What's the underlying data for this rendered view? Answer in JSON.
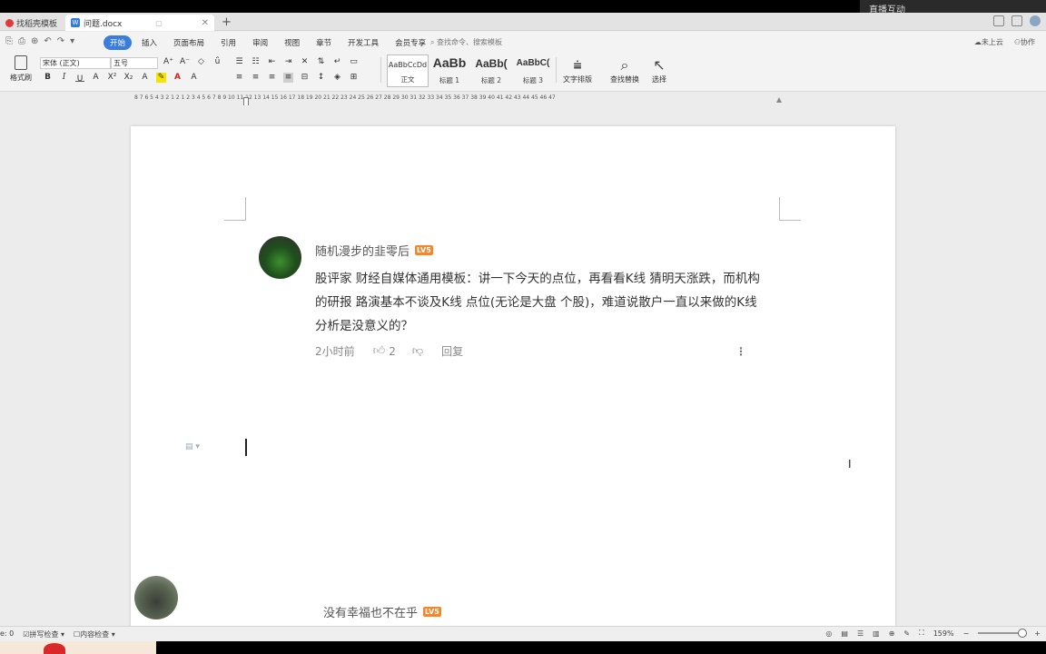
{
  "window": {
    "top_right_text": "直播互动"
  },
  "tabs": [
    {
      "label": "找稻壳模板"
    },
    {
      "label": "问题.docx",
      "icon": "W"
    }
  ],
  "tab_add": "+",
  "quick_access": [
    "⎘",
    "⎙",
    "⊕",
    "↶",
    "↷",
    "▾"
  ],
  "menu": {
    "items": [
      "开始",
      "插入",
      "页面布局",
      "引用",
      "审阅",
      "视图",
      "章节",
      "开发工具",
      "会员专享"
    ],
    "search": "查找命令、搜索模板",
    "right": [
      "未上云",
      "协作"
    ]
  },
  "ribbon": {
    "format_painter": "格式刷",
    "font_name": "宋体 (正文)",
    "font_size": "五号",
    "styles": [
      {
        "sample": "AaBbCcDd",
        "label": "正文"
      },
      {
        "sample": "AaBb",
        "label": "标题 1"
      },
      {
        "sample": "AaBb(",
        "label": "标题 2"
      },
      {
        "sample": "AaBbC(",
        "label": "标题 3"
      }
    ],
    "text_layout": "文字排版",
    "find_replace": "查找替换",
    "select": "选择"
  },
  "ruler": {
    "numbers": "8   7   6   5   4   3   2   1      2   1   2   3   4   5   6   7   8   9  10  11  12  13  14  15  16  17  18  19  20  21  22  23  24  25  26  27  28  29  30  31  32  33  34  35  36  37  38  39  40  41  42  43  44  45  46  47"
  },
  "comment": {
    "username": "随机漫步的韭零后",
    "level": "LV5",
    "text": "股评家 财经自媒体通用模板：讲一下今天的点位，再看看K线 猜明天涨跌，而机构的研报 路演基本不谈及K线 点位(无论是大盘 个股)，难道说散户一直以来做的K线分析是没意义的？",
    "time": "2小时前",
    "likes": "2",
    "reply": "回复"
  },
  "comment2": {
    "username": "没有幸福也不在乎",
    "level": "LV5"
  },
  "statusbar": {
    "page": "e: 0",
    "spell": "拼写检查",
    "content": "内容检查",
    "zoom": "159%"
  }
}
